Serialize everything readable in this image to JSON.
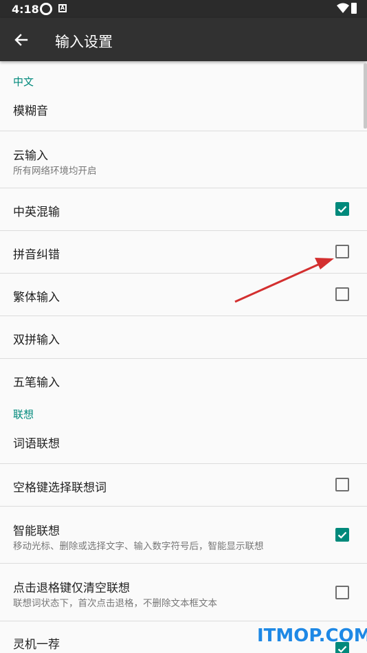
{
  "status_bar": {
    "time": "4:18",
    "notification_letter": "A"
  },
  "app_bar": {
    "title": "输入设置",
    "back_icon": "arrow-left-icon"
  },
  "sections": [
    {
      "header": "中文",
      "items": [
        {
          "title": "模糊音"
        },
        {
          "title": "云输入",
          "summary": "所有网络环境均开启"
        },
        {
          "title": "中英混输",
          "checked": true
        },
        {
          "title": "拼音纠错",
          "checked": false
        },
        {
          "title": "繁体输入",
          "checked": false
        },
        {
          "title": "双拼输入"
        },
        {
          "title": "五笔输入"
        }
      ]
    },
    {
      "header": "联想",
      "items": [
        {
          "title": "词语联想"
        },
        {
          "title": "空格键选择联想词",
          "checked": false
        },
        {
          "title": "智能联想",
          "summary": "移动光标、删除或选择文字、输入数字符号后，智能显示联想",
          "checked": true
        },
        {
          "title": "点击退格键仅清空联想",
          "summary": "联想词状态下，首次点击退格，不删除文本框文本",
          "checked": false
        },
        {
          "title": "灵机一荐",
          "checked": true
        }
      ]
    }
  ],
  "colors": {
    "accent": "#00897b",
    "annotation_arrow": "#d32f2f",
    "watermark": "#1e88e5"
  },
  "watermark": "ITMOP.COM"
}
